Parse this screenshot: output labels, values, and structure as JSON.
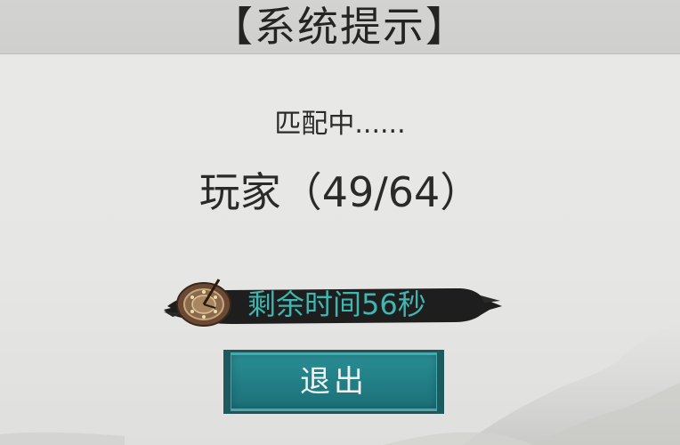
{
  "dialog": {
    "title": "【系统提示】",
    "status": "匹配中......",
    "players": "玩家（49/64）",
    "timer": "剩余时间56秒",
    "exit_label": "退出"
  },
  "icons": {
    "timer": "compass-icon"
  },
  "colors": {
    "background": "#e6e6e4",
    "title_bar": "#d0d0ce",
    "timer_text": "#3fb6b0",
    "button": "#217d84",
    "ink": "#1e1e1e"
  }
}
